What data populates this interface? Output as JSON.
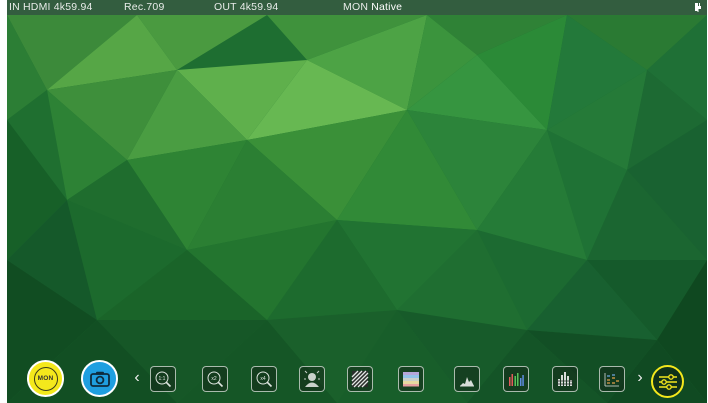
{
  "status_bar": {
    "input": "IN HDMI  4k59.94",
    "color_space": "Rec.709",
    "output": "OUT 4k59.94",
    "monitor_label": "MON",
    "monitor_value": "Native"
  },
  "toolbar": {
    "mon_label": "MON",
    "tools": [
      {
        "name": "zoom-1to1-icon",
        "glyph": "1:1"
      },
      {
        "name": "zoom-x2-icon",
        "glyph": "x2"
      },
      {
        "name": "zoom-x4-icon",
        "glyph": "x4"
      },
      {
        "name": "focus-peaking-icon",
        "glyph": ""
      },
      {
        "name": "zebra-icon",
        "glyph": ""
      },
      {
        "name": "false-color-icon",
        "glyph": ""
      },
      {
        "name": "luma-waveform-icon",
        "glyph": ""
      },
      {
        "name": "rgb-parade-icon",
        "glyph": ""
      },
      {
        "name": "vectorscope-icon",
        "glyph": ""
      },
      {
        "name": "audio-meters-icon",
        "glyph": ""
      }
    ]
  },
  "colors": {
    "mon_button": "#f4e81c",
    "camera_button": "#1f9fe0",
    "settings_ring": "#f4e81c",
    "background": "#1c6b2e"
  }
}
